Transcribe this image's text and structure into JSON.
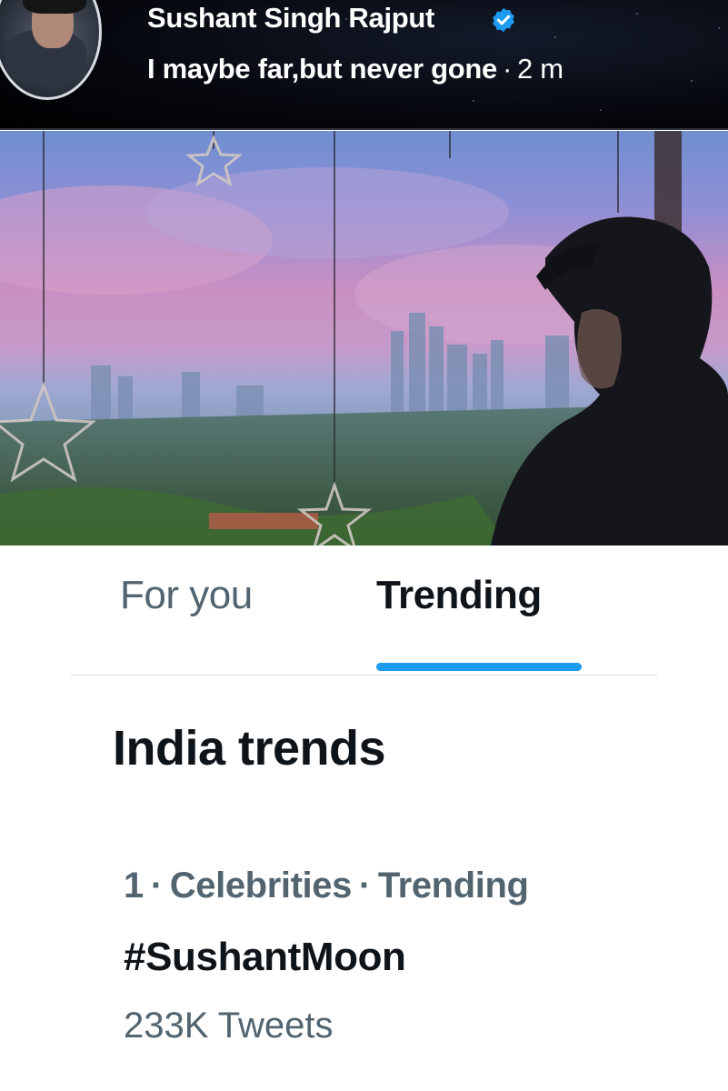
{
  "post": {
    "author_name": "Sushant Singh Rajput",
    "status_text": "I maybe far,but never gone",
    "separator": "·",
    "time_ago": "2 m",
    "verified_icon": "verified-badge-icon",
    "verified_color": "#1d9bf0"
  },
  "tabs": [
    {
      "label": "For you",
      "active": false
    },
    {
      "label": "Trending",
      "active": true
    }
  ],
  "accent_color": "#1d9bf0",
  "section": {
    "title": "India trends"
  },
  "trends": [
    {
      "rank": "1",
      "category": "Celebrities",
      "context": "Trending",
      "separator": "·",
      "hashtag": "#SushantMoon",
      "tweet_count": "233K Tweets"
    }
  ]
}
